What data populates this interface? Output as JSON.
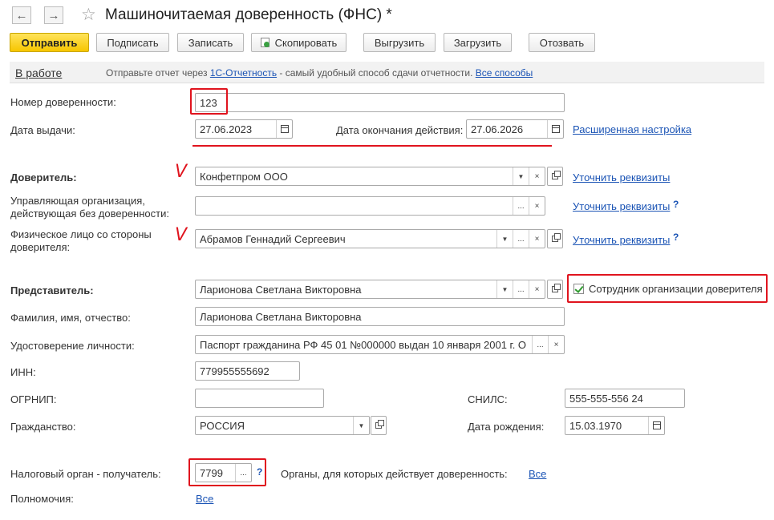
{
  "window": {
    "title": "Машиночитаемая доверенность (ФНС) *",
    "back_glyph": "←",
    "forward_glyph": "→",
    "star_glyph": "☆"
  },
  "toolbar": {
    "send": "Отправить",
    "sign": "Подписать",
    "save": "Записать",
    "copy": "Скопировать",
    "export": "Выгрузить",
    "import": "Загрузить",
    "revoke": "Отозвать"
  },
  "infobar": {
    "status": "В работе",
    "text_before": "Отправьте отчет через ",
    "link1": "1С-Отчетность",
    "text_middle": " - самый удобный способ сдачи отчетности. ",
    "link2": "Все способы"
  },
  "form": {
    "number_label": "Номер доверенности:",
    "number_value": "123",
    "issue_date_label": "Дата выдачи:",
    "issue_date_value": "27.06.2023",
    "end_date_label": "Дата окончания действия:",
    "end_date_value": "27.06.2026",
    "advanced_link": "Расширенная настройка",
    "principal_label": "Доверитель:",
    "principal_value": "Конфетпром ООО",
    "clarify_link": "Уточнить реквизиты",
    "managing_org_label_1": "Управляющая организация,",
    "managing_org_label_2": "действующая без доверенности:",
    "managing_org_value": "",
    "individual_label_1": "Физическое лицо со стороны",
    "individual_label_2": "доверителя:",
    "individual_value": "Абрамов Геннадий Сергеевич",
    "representative_label": "Представитель:",
    "representative_value": "Ларионова Светлана Викторовна",
    "employee_checkbox_label": "Сотрудник организации доверителя",
    "fio_label": "Фамилия, имя, отчество:",
    "fio_value": "Ларионова Светлана Викторовна",
    "id_doc_label": "Удостоверение личности:",
    "id_doc_value": "Паспорт гражданина РФ 45 01 №000000 выдан 10 января 2001 г. О",
    "inn_label": "ИНН:",
    "inn_value": "779955555692",
    "ogrnip_label": "ОГРНИП:",
    "ogrnip_value": "",
    "snils_label": "СНИЛС:",
    "snils_value": "555-555-556 24",
    "citizenship_label": "Гражданство:",
    "citizenship_value": "РОССИЯ",
    "birth_date_label": "Дата рождения:",
    "birth_date_value": "15.03.1970",
    "tax_authority_label": "Налоговый орган - получатель:",
    "tax_authority_value": "7799",
    "bodies_label": "Органы, для которых действует доверенность:",
    "bodies_link": "Все",
    "powers_label": "Полномочия:",
    "powers_link": "Все",
    "help_glyph": "?",
    "more_glyph": "...",
    "clear_glyph": "×",
    "dropdown_glyph": "▼"
  },
  "annotations": {
    "tick_glyph": "V",
    "color": "#e0141e"
  }
}
